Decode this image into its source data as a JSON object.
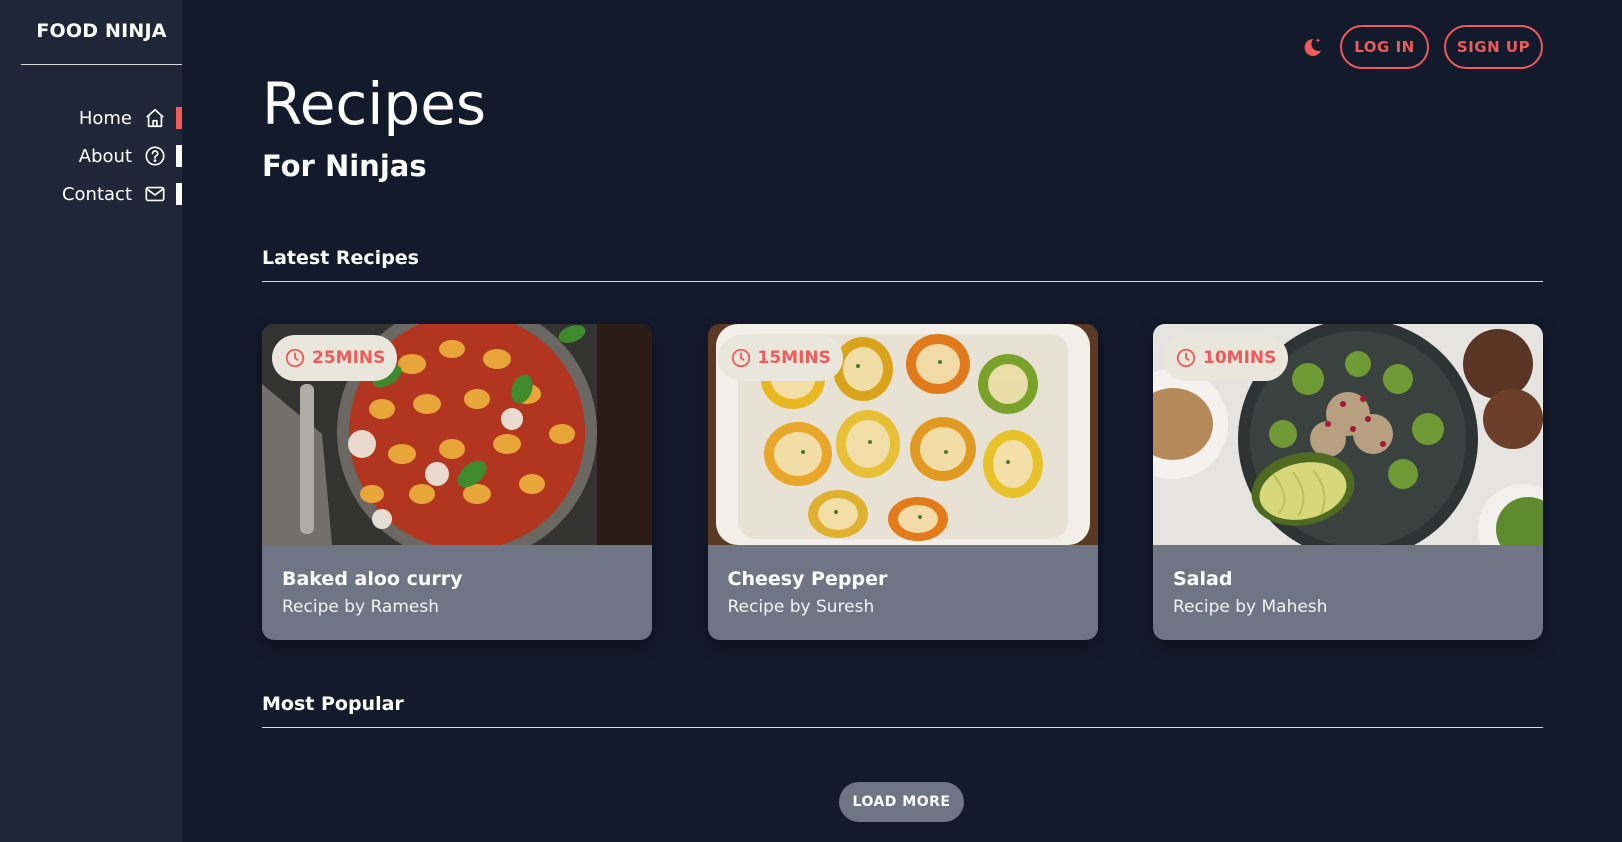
{
  "brand": "FOOD NINJA",
  "nav": [
    {
      "label": "Home",
      "icon": "home-icon",
      "active": true
    },
    {
      "label": "About",
      "icon": "help-circle-icon",
      "active": false
    },
    {
      "label": "Contact",
      "icon": "mail-icon",
      "active": false
    }
  ],
  "header": {
    "login_label": "LOG IN",
    "signup_label": "SIGN UP",
    "theme_icon": "moon-icon"
  },
  "hero": {
    "title": "Recipes",
    "subtitle": "For Ninjas"
  },
  "sections": {
    "latest": "Latest Recipes",
    "popular": "Most Popular"
  },
  "recipes": [
    {
      "time": "25MINS",
      "title": "Baked aloo curry",
      "author": "Recipe by Ramesh"
    },
    {
      "time": "15MINS",
      "title": "Cheesy Pepper",
      "author": "Recipe by Suresh"
    },
    {
      "time": "10MINS",
      "title": "Salad",
      "author": "Recipe by Mahesh"
    }
  ],
  "load_more_label": "LOAD MORE",
  "colors": {
    "background": "#131a2b",
    "sidebar": "#1e2637",
    "accent": "#ef5a5a",
    "card": "#6f7584",
    "badge": "#e9e6dc"
  }
}
